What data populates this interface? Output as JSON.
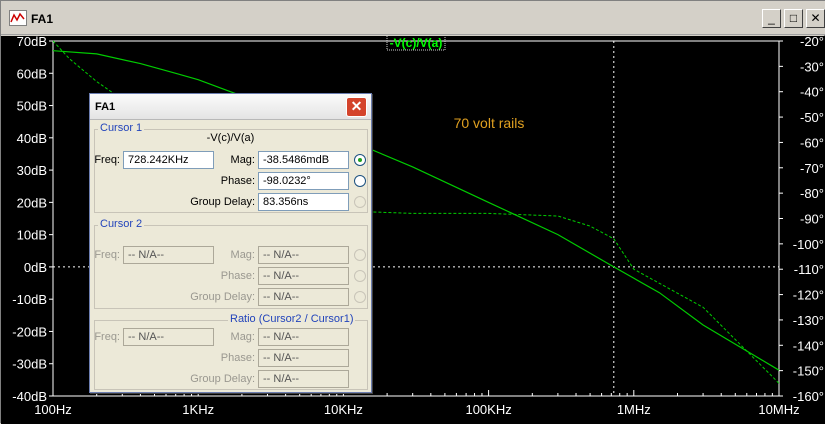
{
  "window": {
    "title": "FA1",
    "minimize_glyph": "_",
    "maximize_glyph": "□",
    "close_glyph": "✕"
  },
  "plot": {
    "trace_label": "-V(c)/V(a)",
    "annotation": "70 volt rails",
    "background": "#000000",
    "trace_color": "#00cc00",
    "grid_color": "#ffffff",
    "left_ticks": [
      "70dB",
      "60dB",
      "50dB",
      "40dB",
      "30dB",
      "20dB",
      "10dB",
      "0dB",
      "-10dB",
      "-20dB",
      "-30dB",
      "-40dB"
    ],
    "right_ticks": [
      "-20°",
      "-30°",
      "-40°",
      "-50°",
      "-60°",
      "-70°",
      "-80°",
      "-90°",
      "-100°",
      "-110°",
      "-120°",
      "-130°",
      "-140°",
      "-150°",
      "-160°"
    ],
    "x_ticks": [
      "100Hz",
      "1KHz",
      "10KHz",
      "100KHz",
      "1MHz",
      "10MHz"
    ]
  },
  "chart_data": {
    "type": "line",
    "x_scale": "log",
    "xlim": [
      100,
      10000000
    ],
    "ylim_left": [
      -40,
      70
    ],
    "ylim_right": [
      -160,
      -20
    ],
    "cursor_x": 728242,
    "series": [
      {
        "axis": "left",
        "style": "solid",
        "points": [
          [
            100,
            67
          ],
          [
            200,
            66
          ],
          [
            400,
            63
          ],
          [
            700,
            60
          ],
          [
            1000,
            58
          ],
          [
            2000,
            53
          ],
          [
            5000,
            46
          ],
          [
            10000,
            40
          ],
          [
            30000,
            31
          ],
          [
            100000,
            20
          ],
          [
            300000,
            10
          ],
          [
            728242,
            0
          ],
          [
            1500000,
            -8
          ],
          [
            3000000,
            -18
          ],
          [
            10000000,
            -32
          ]
        ]
      },
      {
        "axis": "right",
        "style": "dashed",
        "points": [
          [
            100,
            -20
          ],
          [
            130,
            -27
          ],
          [
            200,
            -36
          ],
          [
            400,
            -48
          ],
          [
            1000,
            -62
          ],
          [
            2000,
            -72
          ],
          [
            5000,
            -82
          ],
          [
            10000,
            -87
          ],
          [
            30000,
            -88
          ],
          [
            100000,
            -88
          ],
          [
            300000,
            -89
          ],
          [
            500000,
            -93
          ],
          [
            728242,
            -98
          ],
          [
            1000000,
            -110
          ],
          [
            3000000,
            -125
          ],
          [
            10000000,
            -155
          ]
        ]
      }
    ]
  },
  "dialog": {
    "title": "FA1",
    "close_glyph": "✕",
    "cursor1": {
      "label": "Cursor 1",
      "trace": "-V(c)/V(a)",
      "freq_label": "Freq:",
      "freq": "728.242KHz",
      "mag_label": "Mag:",
      "mag": "-38.5486mdB",
      "phase_label": "Phase:",
      "phase": "-98.0232°",
      "gd_label": "Group Delay:",
      "gd": "83.356ns"
    },
    "cursor2": {
      "label": "Cursor 2",
      "freq_label": "Freq:",
      "freq": "-- N/A--",
      "mag_label": "Mag:",
      "mag": "-- N/A--",
      "phase_label": "Phase:",
      "phase": "-- N/A--",
      "gd_label": "Group Delay:",
      "gd": "-- N/A--"
    },
    "ratio": {
      "label": "Ratio (Cursor2 / Cursor1)",
      "freq_label": "Freq:",
      "freq": "-- N/A--",
      "mag_label": "Mag:",
      "mag": "-- N/A--",
      "phase_label": "Phase:",
      "phase": "-- N/A--",
      "gd_label": "Group Delay:",
      "gd": "-- N/A--"
    }
  }
}
